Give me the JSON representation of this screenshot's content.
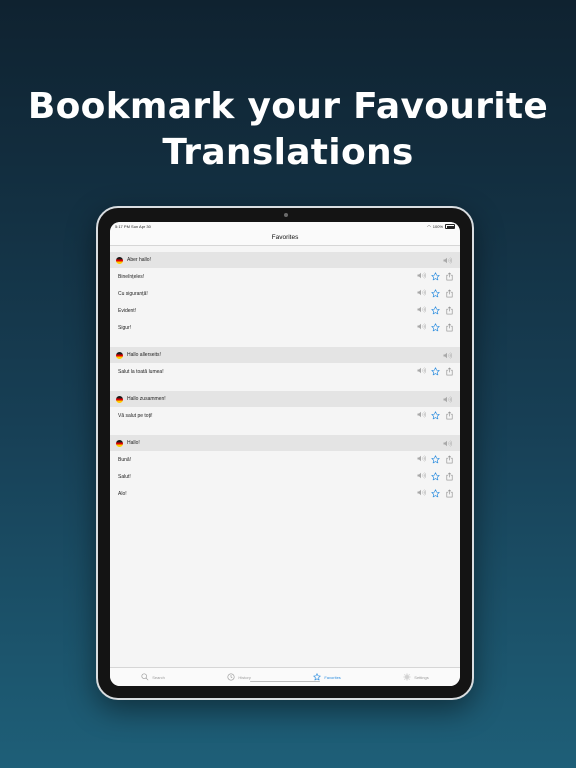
{
  "headline": {
    "line1": "Bookmark your Favourite",
    "line2": "Translations"
  },
  "status": {
    "time": "5:17 PM",
    "date": "Sun Apr 30",
    "battery": "100%"
  },
  "nav": {
    "title": "Favorites"
  },
  "groups": [
    {
      "source": "Aber hallo!",
      "items": [
        "Bineînțeles!",
        "Cu siguranță!",
        "Evident!",
        "Sigur!"
      ]
    },
    {
      "source": "Hallo allerseits!",
      "items": [
        "Salut la toată lumea!"
      ]
    },
    {
      "source": "Hallo zusammen!",
      "items": [
        "Vă salut pe toți!"
      ]
    },
    {
      "source": "Hallo!",
      "items": [
        "Bună!",
        "Salut!",
        "Alo!"
      ]
    }
  ],
  "tabs": [
    {
      "label": "Search",
      "icon": "search-icon"
    },
    {
      "label": "History",
      "icon": "clock-icon"
    },
    {
      "label": "Favorites",
      "icon": "star-icon",
      "active": true
    },
    {
      "label": "Settings",
      "icon": "gear-icon"
    }
  ],
  "colors": {
    "accent": "#2f8fe0",
    "icon_gray": "#9a9a9a",
    "group_header": "#e4e4e4"
  }
}
